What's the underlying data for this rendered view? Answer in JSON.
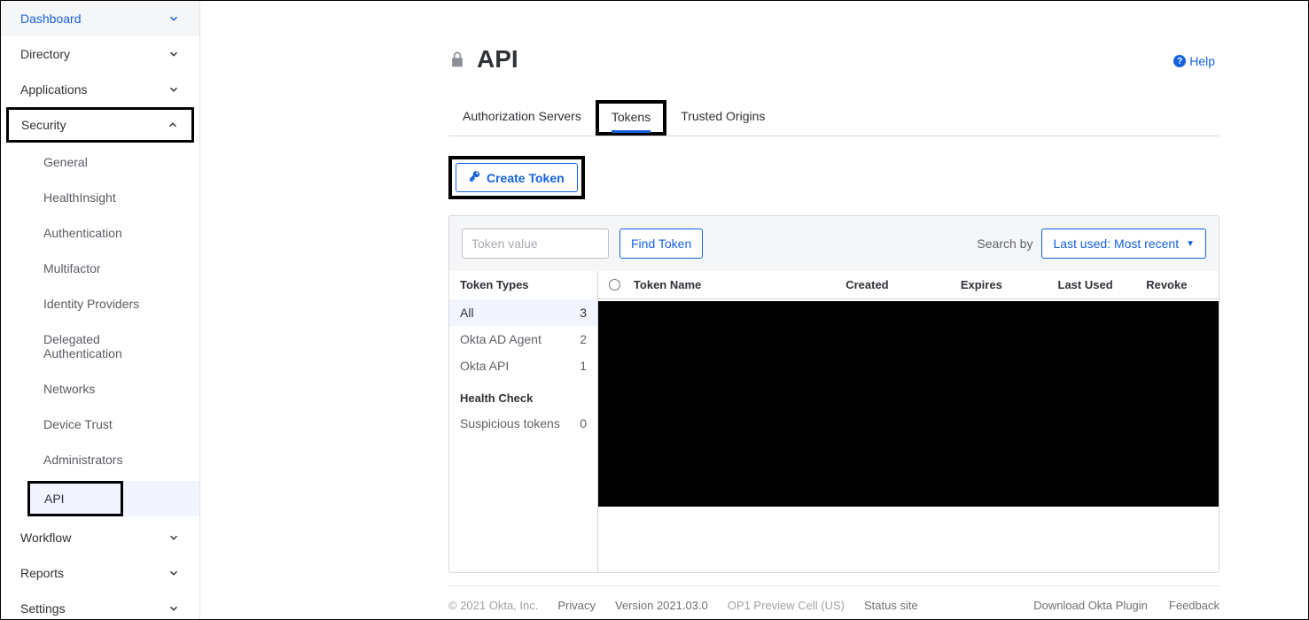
{
  "sidebar": {
    "dashboard": "Dashboard",
    "directory": "Directory",
    "applications": "Applications",
    "security": {
      "label": "Security",
      "items": [
        "General",
        "HealthInsight",
        "Authentication",
        "Multifactor",
        "Identity Providers",
        "Delegated Authentication",
        "Networks",
        "Device Trust",
        "Administrators",
        "API"
      ]
    },
    "workflow": "Workflow",
    "reports": "Reports",
    "settings": "Settings"
  },
  "page": {
    "title": "API",
    "help": "Help"
  },
  "tabs": [
    "Authorization Servers",
    "Tokens",
    "Trusted Origins"
  ],
  "createToken": "Create Token",
  "filter": {
    "placeholder": "Token value",
    "findToken": "Find Token",
    "searchBy": "Search by",
    "sort": "Last used: Most recent"
  },
  "tokenTypes": {
    "header": "Token Types",
    "rows": [
      {
        "label": "All",
        "count": 3
      },
      {
        "label": "Okta AD Agent",
        "count": 2
      },
      {
        "label": "Okta API",
        "count": 1
      }
    ],
    "healthHeader": "Health Check",
    "healthRows": [
      {
        "label": "Suspicious tokens",
        "count": 0
      }
    ]
  },
  "table": {
    "headers": {
      "name": "Token Name",
      "created": "Created",
      "expires": "Expires",
      "lastUsed": "Last Used",
      "revoke": "Revoke"
    }
  },
  "footer": {
    "copyright": "© 2021 Okta, Inc.",
    "privacy": "Privacy",
    "version": "Version 2021.03.0",
    "cell": "OP1 Preview Cell (US)",
    "status": "Status site",
    "download": "Download Okta Plugin",
    "feedback": "Feedback"
  }
}
